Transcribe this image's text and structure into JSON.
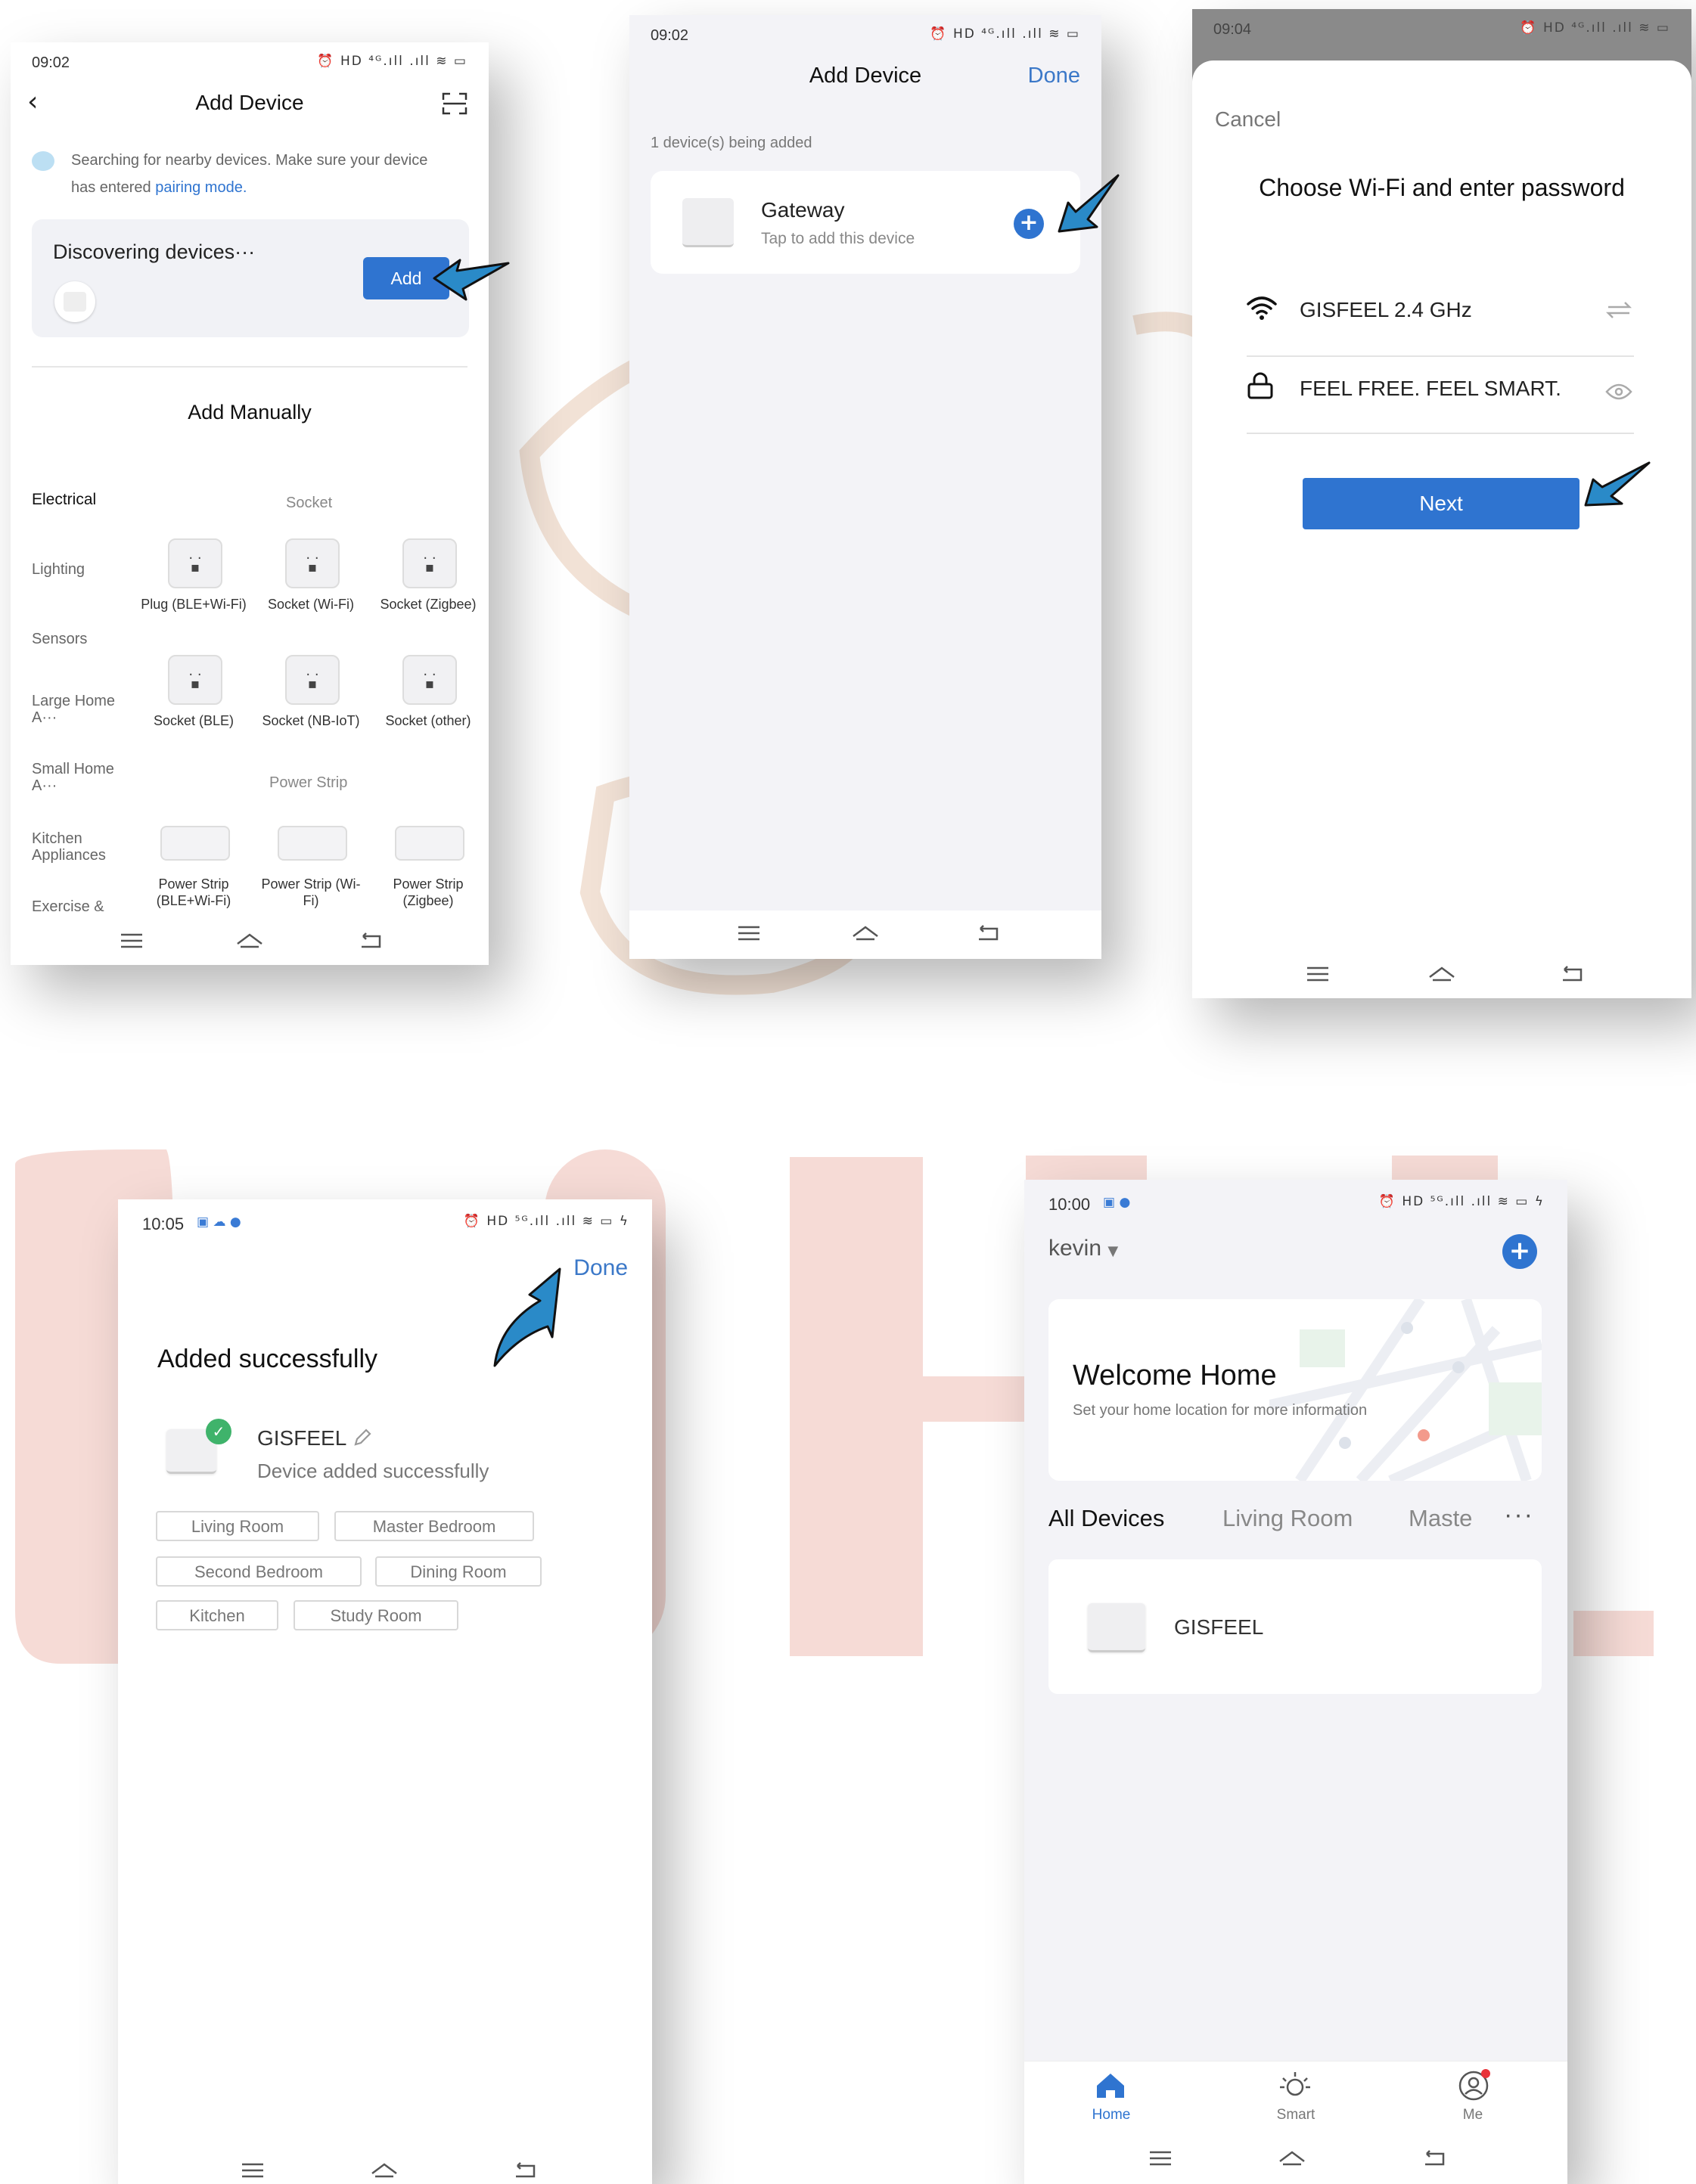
{
  "screen1": {
    "status_time": "09:02",
    "status_icons": "⏰ HD ⁴ᴳ.ıll .ıll ≋ ▭",
    "title": "Add Device",
    "search_hint_pre": "Searching for nearby devices. Make sure your device has entered ",
    "search_hint_link": "pairing mode.",
    "discovering": "Discovering devices···",
    "add_label": "Add",
    "add_manually": "Add Manually",
    "categories": [
      "Electrical",
      "Lighting",
      "Sensors",
      "Large Home A···",
      "Small Home A···",
      "Kitchen Appliances",
      "Exercise &"
    ],
    "socket_section": "Socket",
    "sockets": [
      "Plug (BLE+Wi-Fi)",
      "Socket (Wi-Fi)",
      "Socket (Zigbee)",
      "Socket (BLE)",
      "Socket (NB-IoT)",
      "Socket (other)"
    ],
    "strip_section": "Power Strip",
    "strips": [
      "Power Strip (BLE+Wi-Fi)",
      "Power Strip (Wi-Fi)",
      "Power Strip (Zigbee)"
    ]
  },
  "screen2": {
    "status_time": "09:02",
    "status_icons": "⏰ HD ⁴ᴳ.ıll .ıll ≋ ▭",
    "title": "Add Device",
    "done_label": "Done",
    "count_text": "1 device(s) being added",
    "device_name": "Gateway",
    "device_hint": "Tap to add this device"
  },
  "screen3": {
    "status_time": "09:04",
    "status_icons": "⏰ HD ⁴ᴳ.ıll .ıll ≋ ▭",
    "cancel_label": "Cancel",
    "title": "Choose Wi-Fi and enter password",
    "wifi_name": "GISFEEL 2.4 GHz",
    "password": "FEEL FREE. FEEL SMART.",
    "next_label": "Next"
  },
  "screen4": {
    "status_time": "10:05",
    "status_icons": "⏰ HD ⁵ᴳ.ıll .ıll ≋ ▭ ϟ",
    "done_label": "Done",
    "title": "Added successfully",
    "device_name": "GISFEEL",
    "device_status": "Device added successfully",
    "rooms": [
      "Living Room",
      "Master Bedroom",
      "Second Bedroom",
      "Dining Room",
      "Kitchen",
      "Study Room"
    ]
  },
  "screen5": {
    "status_time": "10:00",
    "status_icons": "⏰ HD ⁵ᴳ.ıll .ıll ≋ ▭ ϟ",
    "home_name": "kevin",
    "welcome_title": "Welcome Home",
    "welcome_sub": "Set your home location for more information",
    "tabs": [
      "All Devices",
      "Living Room",
      "Maste"
    ],
    "more_label": "···",
    "device_name": "GISFEEL",
    "bottom_tabs": [
      "Home",
      "Smart",
      "Me"
    ]
  },
  "colors": {
    "accent_blue": "#2f74d0",
    "done_blue": "#3b78c8",
    "success_green": "#3fb36b",
    "watermark_pink": "#f6d9d4",
    "watermark_tan": "#ead3bd"
  }
}
